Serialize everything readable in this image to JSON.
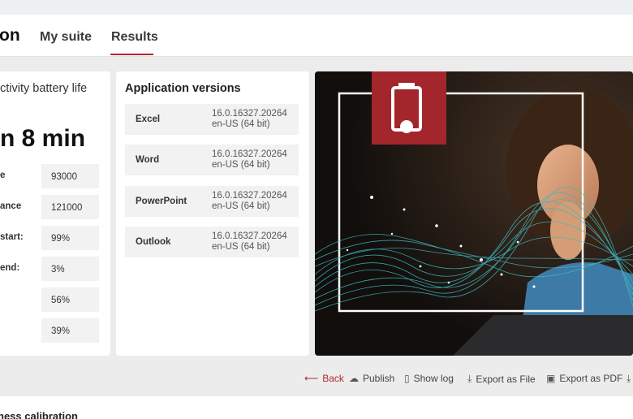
{
  "header": {
    "brand": "on",
    "tabs": [
      {
        "label": "My suite"
      },
      {
        "label": "Results"
      }
    ]
  },
  "battery": {
    "title": "ctivity battery life",
    "time": "n 8 min",
    "stats": [
      {
        "label": "e",
        "value": "93000"
      },
      {
        "label": "ance",
        "value": "121000"
      },
      {
        "label": "start:",
        "value": "99%"
      },
      {
        "label": "end:",
        "value": "3%"
      },
      {
        "label": "",
        "value": "56%"
      },
      {
        "label": "",
        "value": "39%"
      }
    ]
  },
  "versions": {
    "title": "Application versions",
    "apps": [
      {
        "name": "Excel",
        "version": "16.0.16327.20264",
        "locale": "en-US (64 bit)"
      },
      {
        "name": "Word",
        "version": "16.0.16327.20264",
        "locale": "en-US (64 bit)"
      },
      {
        "name": "PowerPoint",
        "version": "16.0.16327.20264",
        "locale": "en-US (64 bit)"
      },
      {
        "name": "Outlook",
        "version": "16.0.16327.20264",
        "locale": "en-US (64 bit)"
      }
    ]
  },
  "actions": {
    "back": "Back",
    "publish": "Publish",
    "show_log": "Show log",
    "export_file": "Export as File",
    "export_pdf": "Export as PDF"
  },
  "bottom": {
    "title": "ness calibration"
  },
  "colors": {
    "accent": "#b3272d",
    "wave": "#3fb7c1"
  },
  "icons": [
    "battery-icon",
    "back-arrow-icon",
    "cloud-upload-icon",
    "document-icon",
    "download-icon",
    "save-icon"
  ]
}
